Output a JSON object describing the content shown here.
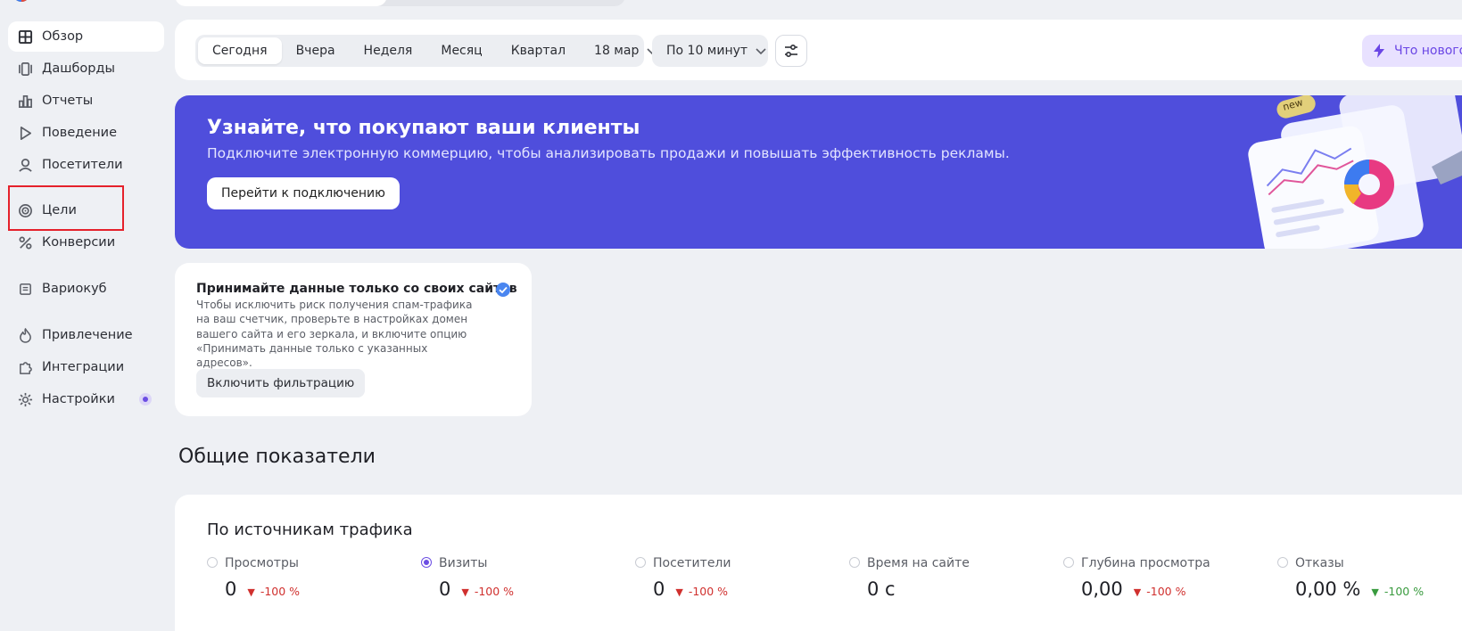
{
  "sidebar": {
    "items": [
      {
        "label": "Обзор",
        "icon": "grid-icon",
        "active": true
      },
      {
        "label": "Дашборды",
        "icon": "dashboards-icon"
      },
      {
        "label": "Отчеты",
        "icon": "bar-chart-icon"
      },
      {
        "label": "Поведение",
        "icon": "play-icon"
      },
      {
        "label": "Посетители",
        "icon": "user-icon"
      },
      {
        "label": "Цели",
        "icon": "target-icon"
      },
      {
        "label": "Конверсии",
        "icon": "percent-icon"
      },
      {
        "label": "Вариокуб",
        "icon": "cube-icon"
      },
      {
        "label": "Привлечение",
        "icon": "flame-icon"
      },
      {
        "label": "Интеграции",
        "icon": "puzzle-icon"
      },
      {
        "label": "Настройки",
        "icon": "gear-icon",
        "badge": true
      }
    ]
  },
  "toolbar": {
    "periods": [
      "Сегодня",
      "Вчера",
      "Неделя",
      "Месяц",
      "Квартал"
    ],
    "active_period": "Сегодня",
    "date_select": "18 мар",
    "granularity": "По 10 минут",
    "whats_new": "Что нового"
  },
  "banner": {
    "title": "Узнайте, что покупают ваши клиенты",
    "subtitle": "Подключите электронную коммерцию, чтобы анализировать продажи и повышать эффективность рекламы.",
    "button": "Перейти к подключению",
    "art_badge": "new"
  },
  "spam_card": {
    "title": "Принимайте данные только со своих сайтов",
    "text": "Чтобы исключить риск получения спам-трафика на ваш счетчик, проверьте в настройках домен вашего сайта и его зеркала, и включите опцию «Принимать данные только с указанных адресов».",
    "button": "Включить фильтрацию"
  },
  "section_title": "Общие показатели",
  "metrics": {
    "title": "По источникам трафика",
    "items": [
      {
        "label": "Просмотры",
        "value": "0",
        "delta": "-100 %",
        "trend": "down",
        "selected": false
      },
      {
        "label": "Визиты",
        "value": "0",
        "delta": "-100 %",
        "trend": "down",
        "selected": true
      },
      {
        "label": "Посетители",
        "value": "0",
        "delta": "-100 %",
        "trend": "down",
        "selected": false
      },
      {
        "label": "Время на сайте",
        "value": "0 с",
        "delta": "",
        "trend": "none",
        "selected": false
      },
      {
        "label": "Глубина просмотра",
        "value": "0,00",
        "delta": "-100 %",
        "trend": "down",
        "selected": false
      },
      {
        "label": "Отказы",
        "value": "0,00 %",
        "delta": "-100 %",
        "trend": "up-good",
        "selected": false
      }
    ]
  },
  "colors": {
    "accent": "#6c4ee3",
    "banner": "#4f4edc",
    "negative": "#d0302e",
    "positive": "#3a9b3f",
    "highlight_box": "#e5212b"
  }
}
